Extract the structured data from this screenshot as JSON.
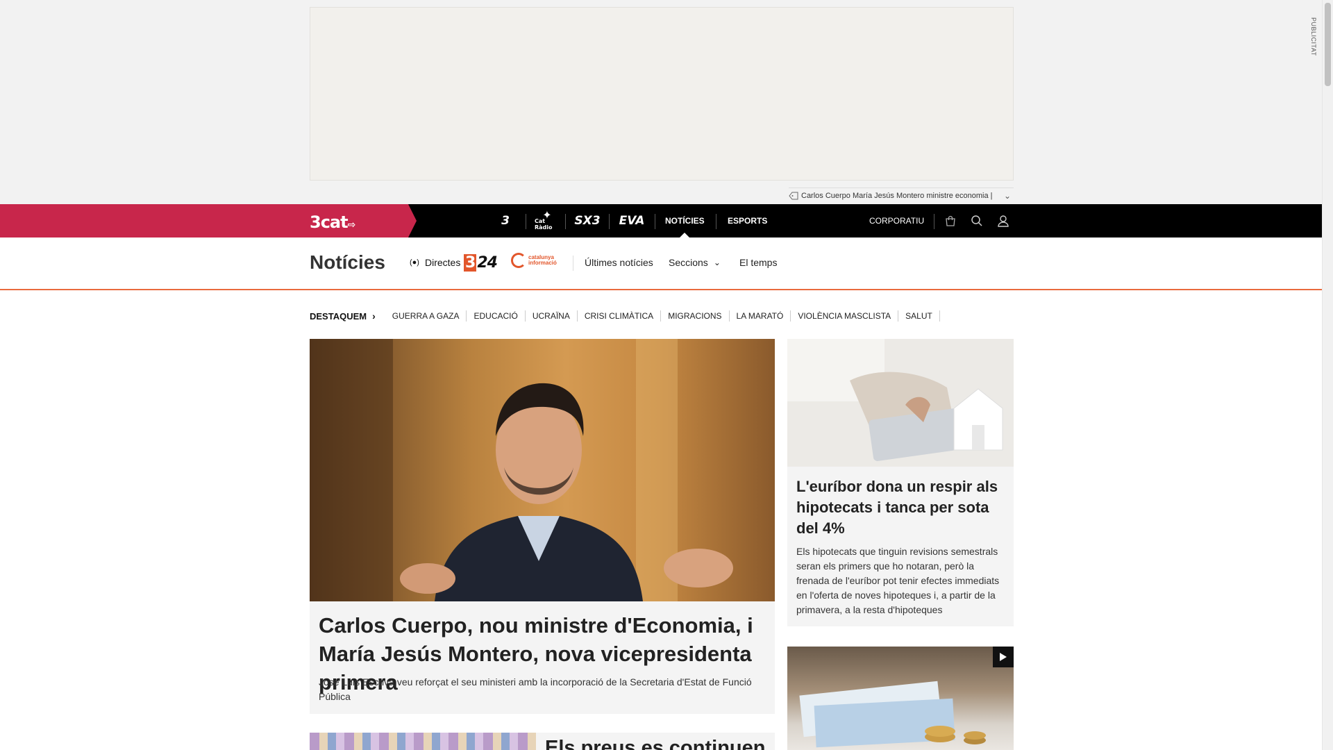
{
  "ad": {
    "label": "PUBLICITAT",
    "tag_text": "Carlos Cuerpo María Jesús Montero ministre economia |"
  },
  "topbar": {
    "logo": "3cat",
    "brands": [
      "3",
      "Cat Ràdio",
      "SX3",
      "EVA"
    ],
    "nav": [
      "NOTÍCIES",
      "ESPORTS"
    ],
    "corporate": "CORPORATIU"
  },
  "section": {
    "title": "Notícies",
    "directes": "Directes",
    "logo_324": "24",
    "logo_324_prefix": "3",
    "logo_ci": [
      "catalunya",
      "informació"
    ],
    "nav": [
      "Últimes notícies",
      "Seccions",
      "El temps"
    ]
  },
  "highlights": {
    "label": "DESTAQUEM",
    "items": [
      "GUERRA A GAZA",
      "EDUCACIÓ",
      "UCRAÏNA",
      "CRISI CLIMÀTICA",
      "MIGRACIONS",
      "LA MARATÓ",
      "VIOLÈNCIA MASCLISTA",
      "SALUT"
    ]
  },
  "main_article": {
    "headline": "Carlos Cuerpo, nou ministre d'Economia, i María Jesús Montero, nova vicepresidenta primera",
    "lead": "José Luis Escrivá veu reforçat el seu ministeri amb la incorporació de la Secretaria d'Estat de Funció Pública"
  },
  "side_article": {
    "headline": "L'euríbor dona un respir als hipotecats i tanca per sota del 4%",
    "lead": "Els hipotecats que tinguin revisions semestrals seran els primers que ho notaran, però la frenada de l'euríbor pot tenir efectes immediats en l'oferta de noves hipoteques i, a partir de la primavera, a la resta d'hipoteques"
  },
  "bottom_article": {
    "headline": "Els preus es continuen"
  },
  "colors": {
    "brand_red": "#c8264b",
    "accent_orange": "#e96a3c",
    "topbar_bg": "#000000"
  }
}
